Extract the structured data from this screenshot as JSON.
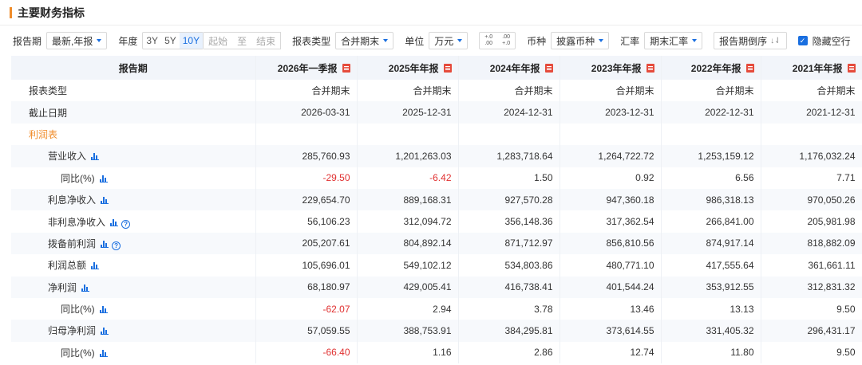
{
  "title": "主要财务指标",
  "toolbar": {
    "period_label": "报告期",
    "period_value": "最新,年报",
    "year_label": "年度",
    "year_options": [
      "3Y",
      "5Y",
      "10Y"
    ],
    "year_selected": "10Y",
    "range_start": "起始",
    "range_to": "至",
    "range_end": "结束",
    "report_type_label": "报表类型",
    "report_type_value": "合并期末",
    "unit_label": "单位",
    "unit_value": "万元",
    "dec_increase": "+.0\n.00",
    "dec_decrease": ".00\n+.0",
    "currency_label": "币种",
    "currency_value": "披露币种",
    "rate_label": "汇率",
    "rate_value": "期末汇率",
    "sort_label": "报告期倒序",
    "hide_empty_label": "隐藏空行"
  },
  "table": {
    "header_first": "报告期",
    "columns": [
      "2026年一季报",
      "2025年年报",
      "2024年年报",
      "2023年年报",
      "2022年年报",
      "2021年年报"
    ],
    "rows": [
      {
        "label": "报表类型",
        "values": [
          "合并期末",
          "合并期末",
          "合并期末",
          "合并期末",
          "合并期末",
          "合并期末"
        ]
      },
      {
        "label": "截止日期",
        "values": [
          "2026-03-31",
          "2025-12-31",
          "2024-12-31",
          "2023-12-31",
          "2022-12-31",
          "2021-12-31"
        ]
      },
      {
        "label": "利润表",
        "values": [
          "",
          "",
          "",
          "",
          "",
          ""
        ]
      },
      {
        "label": "营业收入",
        "values": [
          "285,760.93",
          "1,201,263.03",
          "1,283,718.64",
          "1,264,722.72",
          "1,253,159.12",
          "1,176,032.24"
        ]
      },
      {
        "label": "同比(%)",
        "values": [
          "-29.50",
          "-6.42",
          "1.50",
          "0.92",
          "6.56",
          "7.71"
        ]
      },
      {
        "label": "利息净收入",
        "values": [
          "229,654.70",
          "889,168.31",
          "927,570.28",
          "947,360.18",
          "986,318.13",
          "970,050.26"
        ]
      },
      {
        "label": "非利息净收入",
        "values": [
          "56,106.23",
          "312,094.72",
          "356,148.36",
          "317,362.54",
          "266,841.00",
          "205,981.98"
        ]
      },
      {
        "label": "拨备前利润",
        "values": [
          "205,207.61",
          "804,892.14",
          "871,712.97",
          "856,810.56",
          "874,917.14",
          "818,882.09"
        ]
      },
      {
        "label": "利润总额",
        "values": [
          "105,696.01",
          "549,102.12",
          "534,803.86",
          "480,771.10",
          "417,555.64",
          "361,661.11"
        ]
      },
      {
        "label": "净利润",
        "values": [
          "68,180.97",
          "429,005.41",
          "416,738.41",
          "401,544.24",
          "353,912.55",
          "312,831.32"
        ]
      },
      {
        "label": "同比(%)",
        "values": [
          "-62.07",
          "2.94",
          "3.78",
          "13.46",
          "13.13",
          "9.50"
        ]
      },
      {
        "label": "归母净利润",
        "values": [
          "57,059.55",
          "388,753.91",
          "384,295.81",
          "373,614.55",
          "331,405.32",
          "296,431.17"
        ]
      },
      {
        "label": "同比(%)",
        "values": [
          "-66.40",
          "1.16",
          "2.86",
          "12.74",
          "11.80",
          "9.50"
        ]
      }
    ]
  },
  "colors": {
    "accent": "#f08c2a",
    "link": "#1a6fe0",
    "negative": "#e03030"
  }
}
